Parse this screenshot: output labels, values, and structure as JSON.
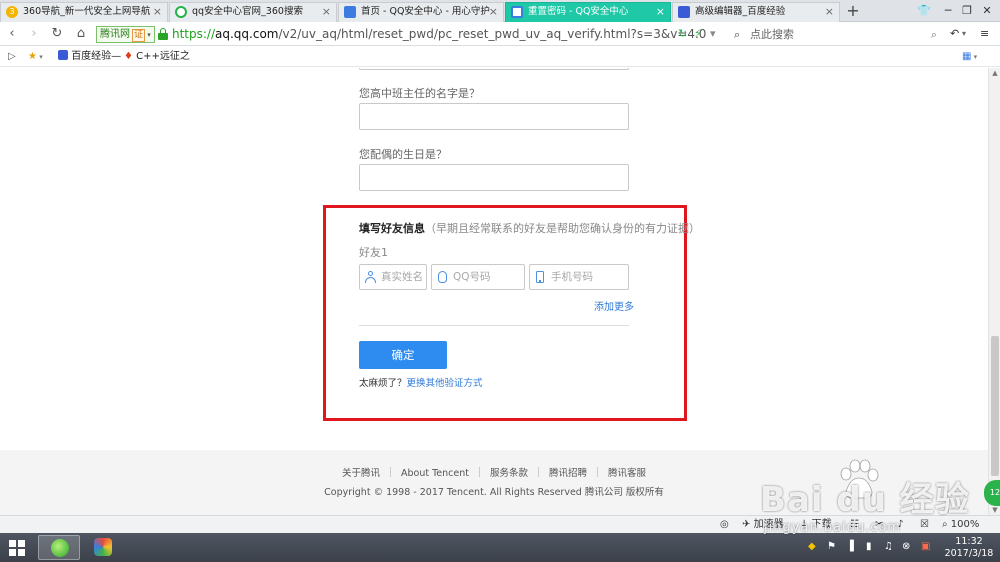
{
  "tabs": [
    {
      "title": "360导航_新一代安全上网导航",
      "active": false
    },
    {
      "title": "qq安全中心官网_360搜索",
      "active": false
    },
    {
      "title": "首页 - QQ安全中心 - 用心守护",
      "active": false
    },
    {
      "title": "重置密码 - QQ安全中心",
      "active": true
    },
    {
      "title": "高级编辑器_百度经验",
      "active": false
    }
  ],
  "tab_close": "×",
  "new_tab": "+",
  "window_controls": {
    "minimize": "─",
    "restore": "❐",
    "close": "✕"
  },
  "address": {
    "site_name": "腾讯网",
    "cert_label": "证",
    "url_protocol": "https://",
    "url_host": "aq.qq.com",
    "url_path": "/v2/uv_aq/html/reset_pwd/pc_reset_pwd_uv_aq_verify.html?s=3&v=4.0",
    "search_placeholder": "点此搜索"
  },
  "bookmarks": [
    {
      "label": "百度经验—"
    },
    {
      "label": "C++远征之"
    }
  ],
  "form": {
    "teacher_question": "您高中班主任的名字是？",
    "spouse_question": "您配偶的生日是？",
    "friend_section_title": "填写好友信息",
    "friend_section_note": "（早期且经常联系的好友是帮助您确认身份的有力证据）",
    "friend1_label": "好友1",
    "name_placeholder": "真实姓名",
    "qq_placeholder": "QQ号码",
    "phone_placeholder": "手机号码",
    "add_more": "添加更多",
    "confirm_button": "确定",
    "alt_prefix": "太麻烦了？",
    "alt_link": "更换其他验证方式"
  },
  "footer": {
    "links": [
      "关于腾讯",
      "About Tencent",
      "服务条款",
      "腾讯招聘",
      "腾讯客服"
    ],
    "copyright": "Copyright © 1998 - 2017 Tencent. All Rights Reserved 腾讯公司 版权所有"
  },
  "statusbar": {
    "accelerator": "加速器",
    "download": "下载",
    "zoom": "100%"
  },
  "taskbar": {
    "time": "11:32",
    "date": "2017/3/18"
  },
  "watermark": {
    "text": "Bai du 经验",
    "sub": "jingyan.baidu.com"
  },
  "colors": {
    "active_tab": "#1fc9a7",
    "highlight_border": "#e0161f",
    "confirm_button": "#2e8bf0",
    "link": "#2f7ad8"
  }
}
